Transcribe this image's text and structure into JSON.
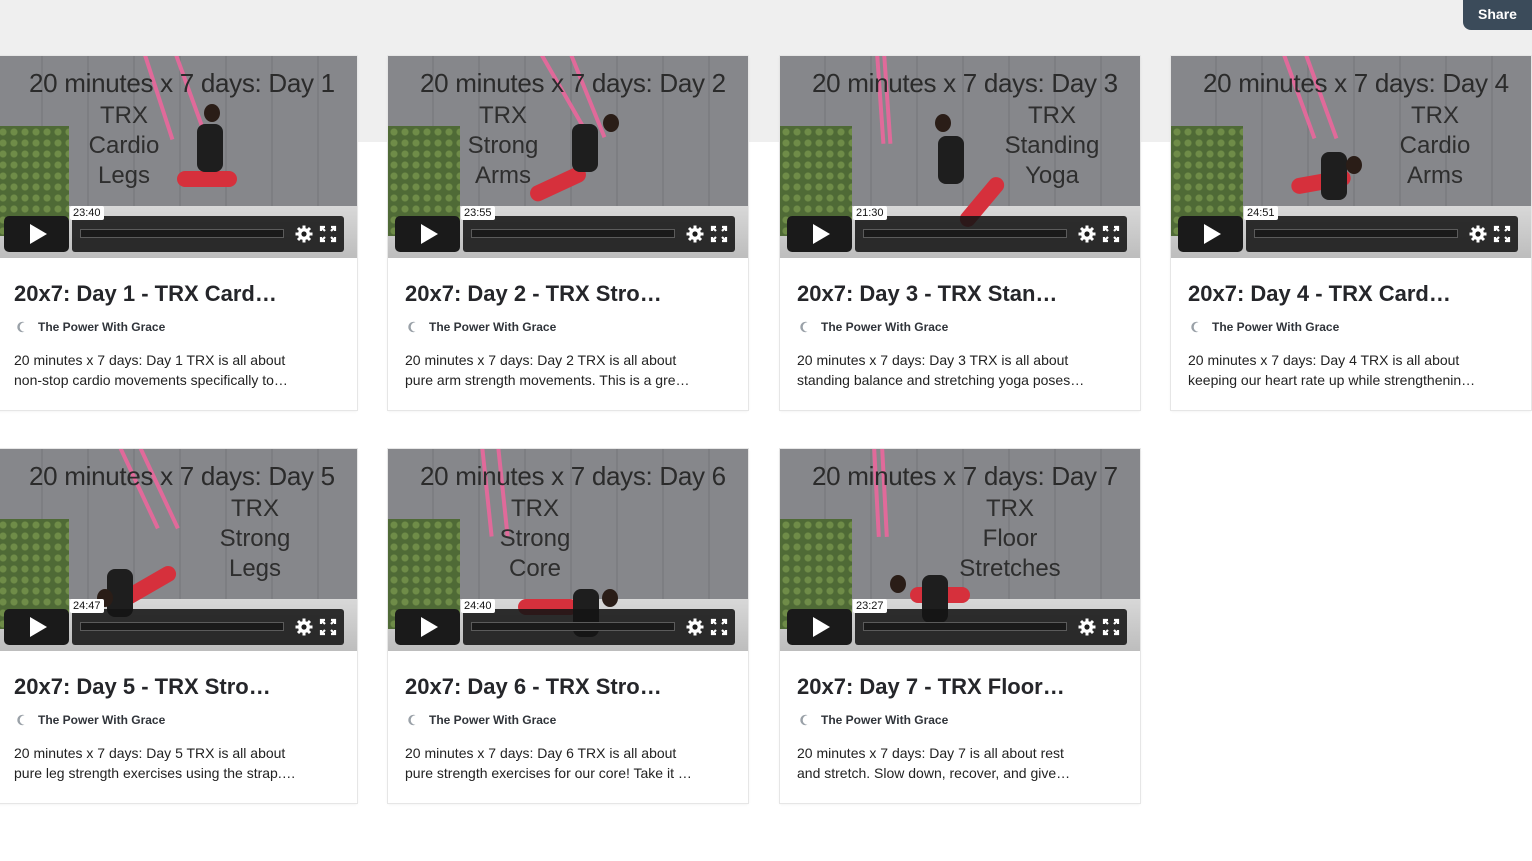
{
  "share_label": "Share",
  "videos": [
    {
      "title_line": "20 minutes x 7 days: Day 1",
      "sub": "TRX\nCardio\nLegs",
      "duration": "23:40",
      "card_title": "20x7: Day 1 - TRX Card…",
      "channel": "The Power With Grace",
      "desc1": "20 minutes x 7 days: Day 1 TRX is all about",
      "desc2": "non-stop cardio movements specifically to…"
    },
    {
      "title_line": "20 minutes x 7 days: Day 2",
      "sub": "TRX\nStrong\nArms",
      "duration": "23:55",
      "card_title": "20x7: Day 2 - TRX Stro…",
      "channel": "The Power With Grace",
      "desc1": "20 minutes x 7 days: Day 2 TRX is all about",
      "desc2": "pure arm strength movements. This is a gre…"
    },
    {
      "title_line": "20 minutes x 7 days: Day 3",
      "sub": "TRX\nStanding\nYoga",
      "duration": "21:30",
      "card_title": "20x7: Day 3 - TRX Stan…",
      "channel": "The Power With Grace",
      "desc1": "20 minutes x 7 days: Day 3 TRX is all about",
      "desc2": "standing balance and stretching yoga poses…"
    },
    {
      "title_line": "20 minutes x 7 days: Day 4",
      "sub": "TRX\nCardio\nArms",
      "duration": "24:51",
      "card_title": "20x7: Day 4 - TRX Card…",
      "channel": "The Power With Grace",
      "desc1": "20 minutes x 7 days: Day 4 TRX is all about",
      "desc2": "keeping our heart rate up while strengthenin…"
    },
    {
      "title_line": "20 minutes x 7 days: Day 5",
      "sub": "TRX\nStrong\nLegs",
      "duration": "24:47",
      "card_title": "20x7: Day 5 - TRX Stro…",
      "channel": "The Power With Grace",
      "desc1": "20 minutes x 7 days: Day 5 TRX is all about",
      "desc2": "pure leg strength exercises using the strap.…"
    },
    {
      "title_line": "20 minutes x 7 days: Day 6",
      "sub": "TRX\nStrong\nCore",
      "duration": "24:40",
      "card_title": "20x7: Day 6 - TRX Stro…",
      "channel": "The Power With Grace",
      "desc1": "20 minutes x 7 days: Day 6 TRX is all about",
      "desc2": "pure strength exercises for our core! Take it …"
    },
    {
      "title_line": "20 minutes x 7 days: Day 7",
      "sub": "TRX\nFloor\nStretches",
      "duration": "23:27",
      "card_title": "20x7: Day 7 - TRX Floor…",
      "channel": "The Power With Grace",
      "desc1": "20 minutes x 7 days: Day 7 is all about rest",
      "desc2": "and stretch. Slow down, recover, and give…"
    }
  ]
}
